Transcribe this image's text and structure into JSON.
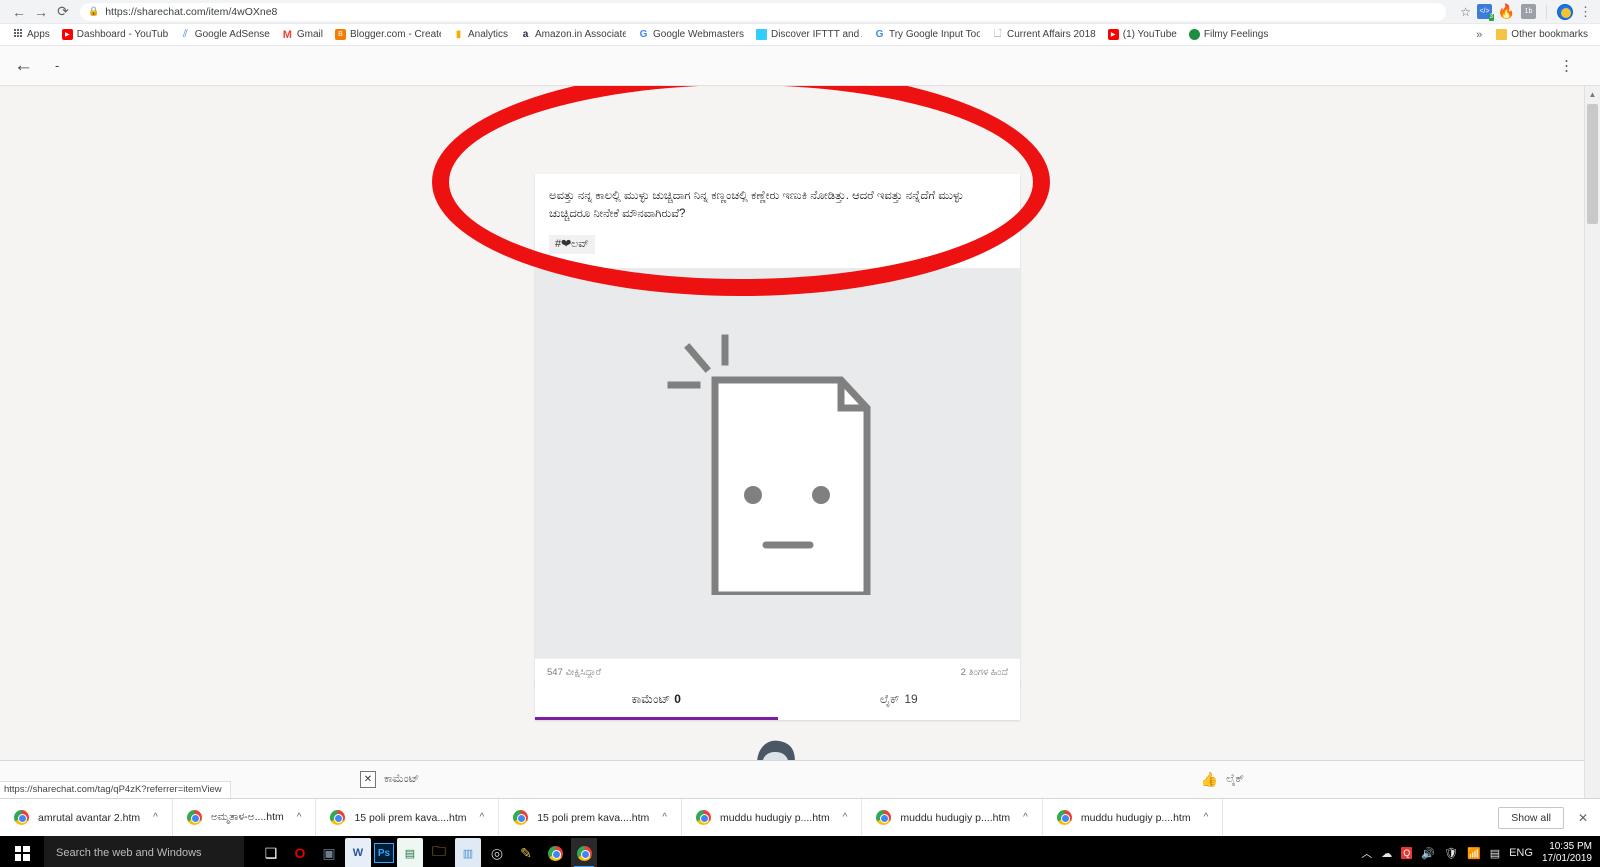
{
  "browser": {
    "back_icon": "back-arrow-icon",
    "forward_icon": "forward-arrow-icon",
    "reload_icon": "reload-icon",
    "lock_icon": "lock-icon",
    "url": "https://sharechat.com/item/4wOXne8",
    "star_icon": "star-icon",
    "menu_icon": "kebab-menu-icon",
    "extensions": [
      {
        "name": "code-extension-icon",
        "glyph": "</>",
        "badge": "3"
      },
      {
        "name": "firebase-extension-icon",
        "glyph": "🔥",
        "badge": ""
      },
      {
        "name": "onebox-extension-icon",
        "glyph": "1b",
        "badge": ""
      }
    ],
    "profile_icon": "profile-avatar-icon"
  },
  "bookmarks": {
    "apps_label": "Apps",
    "items": [
      {
        "label": "Dashboard - YouTube",
        "icon": "youtube-icon"
      },
      {
        "label": "Google AdSense",
        "icon": "adsense-icon"
      },
      {
        "label": "Gmail",
        "icon": "gmail-icon"
      },
      {
        "label": "Blogger.com - Create",
        "icon": "blogger-icon"
      },
      {
        "label": "Analytics",
        "icon": "analytics-icon"
      },
      {
        "label": "Amazon.in Associates",
        "icon": "amazon-icon"
      },
      {
        "label": "Google Webmasters",
        "icon": "google-icon"
      },
      {
        "label": "Discover IFTTT and A",
        "icon": "ifttt-icon"
      },
      {
        "label": "Try Google Input Tool",
        "icon": "google-icon"
      },
      {
        "label": "Current Affairs 2018 ",
        "icon": "document-icon"
      },
      {
        "label": "(1) YouTube",
        "icon": "youtube-icon"
      },
      {
        "label": "Filmy Feelings",
        "icon": "filmy-feelings-icon"
      }
    ],
    "overflow_icon": "chevron-double-right-icon",
    "other_bookmarks": "Other bookmarks"
  },
  "page_toolbar": {
    "back_icon": "page-back-arrow-icon",
    "title": "-",
    "menu_icon": "page-kebab-menu-icon"
  },
  "post": {
    "text": "ಅವತ್ತು ನನ್ನ ಕಾಲಲ್ಲಿ ಮುಳ್ಳು ಚುಚ್ಚಿದಾಗ ನಿನ್ನ ಕಣ್ಣಂಚಲ್ಲಿ ಕಣ್ಣೇರು ಇಣುಕಿ ನೋಡಿತ್ತು. ಆದರೆ ಇವತ್ತು ನನ್ನೆದೆಗೆ ಮುಳ್ಳು ಚುಚ್ಚಿದರೂ ನೀನೇಕೆ ಮೌನವಾಗಿರುವೆ?",
    "hashtag": "#❤ಲವ್",
    "media_placeholder_icon": "broken-image-sad-document-icon",
    "views": "547 ವೀಕ್ಷಿಸಿದ್ದಾರೆ",
    "time_ago": "2 ತಿಂಗಳ ಹಿಂದೆ"
  },
  "tabs": [
    {
      "label": "ಕಾಮೆಂಟ್",
      "count": "0",
      "active": true,
      "name": "tab-comments"
    },
    {
      "label": "ಲೈಕ್",
      "count": "19",
      "active": false,
      "name": "tab-likes"
    }
  ],
  "empty_state": {
    "avatar_icon": "person-avatar-illustration"
  },
  "action_bar": {
    "comment_icon": "broken-image-icon",
    "comment_glyph": "✕",
    "comment_label": "ಕಾಮೆಂಟ್",
    "like_icon": "thumbs-up-icon",
    "like_glyph": "👍",
    "like_label": "ಲೈಕ್"
  },
  "status_url": "https://sharechat.com/tag/qP4zK?referrer=itemView",
  "downloads": {
    "items": [
      {
        "name": "amrutal avantar 2.htm"
      },
      {
        "name": "ಅಮ್ಮತಾಳ-ಅ....htm"
      },
      {
        "name": "15 poli prem kava....htm"
      },
      {
        "name": "15 poli prem kava....htm"
      },
      {
        "name": "muddu hudugiy p....htm"
      },
      {
        "name": "muddu hudugiy p....htm"
      },
      {
        "name": "muddu hudugiy p....htm"
      }
    ],
    "show_all": "Show all",
    "close_icon": "close-icon"
  },
  "taskbar": {
    "start_icon": "windows-start-icon",
    "search_placeholder": "Search the web and Windows",
    "icons": [
      {
        "name": "task-view-icon",
        "glyph": "❑"
      },
      {
        "name": "opera-icon",
        "glyph": "O"
      },
      {
        "name": "app-icon",
        "glyph": "▣"
      },
      {
        "name": "word-icon",
        "glyph": "W"
      },
      {
        "name": "photoshop-icon",
        "glyph": "Ps"
      },
      {
        "name": "excel-icon",
        "glyph": "▤"
      },
      {
        "name": "file-explorer-icon",
        "glyph": "📁"
      },
      {
        "name": "news-app-icon",
        "glyph": "▥"
      },
      {
        "name": "camera-icon",
        "glyph": "◎"
      },
      {
        "name": "paint-icon",
        "glyph": "✎"
      },
      {
        "name": "chrome-icon",
        "glyph": "◉"
      },
      {
        "name": "chrome-active-icon",
        "glyph": "◉"
      }
    ],
    "tray": [
      {
        "name": "tray-expand-icon",
        "glyph": "︿"
      },
      {
        "name": "onedrive-icon",
        "glyph": "☁"
      },
      {
        "name": "search-tray-icon",
        "glyph": "Q"
      },
      {
        "name": "volume-icon",
        "glyph": "🔊"
      },
      {
        "name": "security-icon",
        "glyph": "🛡"
      },
      {
        "name": "network-icon",
        "glyph": "📶"
      },
      {
        "name": "notification-icon",
        "glyph": "▤"
      }
    ],
    "language": "ENG",
    "time": "10:35 PM",
    "date": "17/01/2019"
  },
  "colors": {
    "accent_purple": "#7b1fa2",
    "annotation_red": "#ee1111",
    "media_bg": "#e8eaec"
  }
}
